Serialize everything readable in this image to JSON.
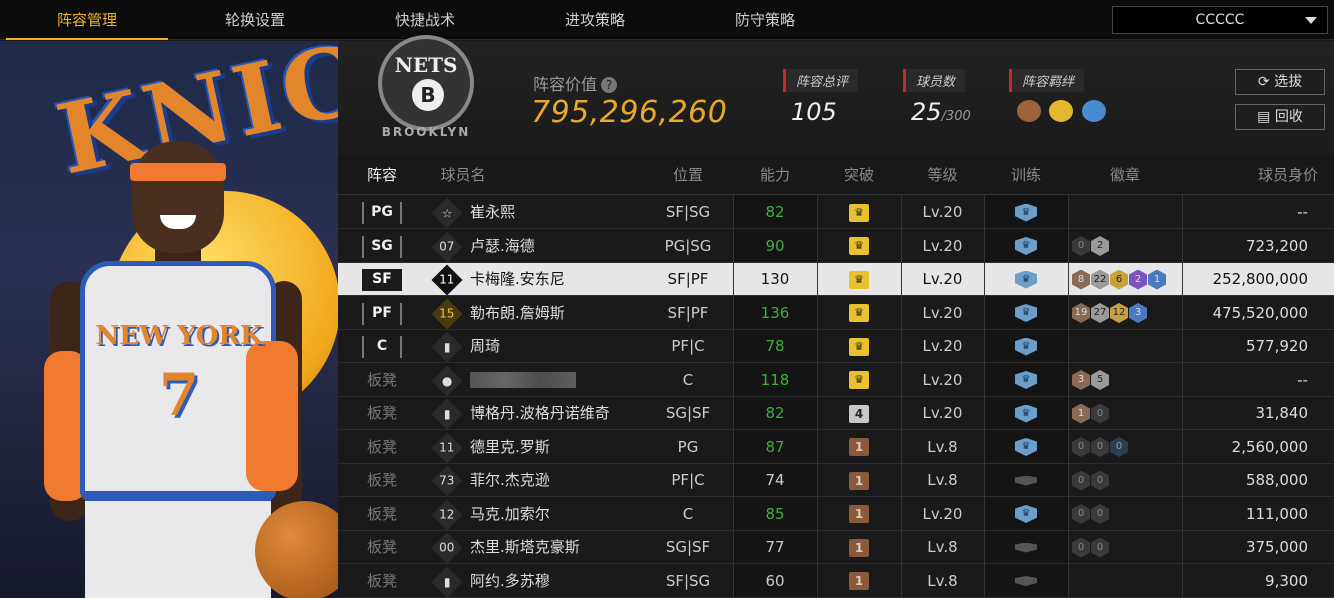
{
  "tabs": [
    "阵容管理",
    "轮换设置",
    "快捷战术",
    "进攻策略",
    "防守策略"
  ],
  "active_tab": 0,
  "team_select": {
    "value": "CCCCC"
  },
  "team_logo": {
    "top": "NETS",
    "letter": "B",
    "bottom": "BROOKLYN"
  },
  "art": {
    "sign": "KNICKS",
    "jersey_text": "NEW YORK",
    "jersey_number": "7"
  },
  "lineup_value": {
    "label": "阵容价值",
    "value": "795,296,260"
  },
  "overall": {
    "label": "阵容总评",
    "value": "105"
  },
  "player_count": {
    "label": "球员数",
    "value": "25",
    "max": "/300"
  },
  "bonds": {
    "label": "阵容羁绊",
    "icons": [
      "bond-icon-bronze",
      "bond-icon-gold",
      "bond-icon-blue"
    ]
  },
  "buttons": {
    "pick": "选拔",
    "recycle": "回收"
  },
  "columns": [
    "阵容",
    "球员名",
    "位置",
    "能力",
    "突破",
    "等级",
    "训练",
    "徽章",
    "球员身价"
  ],
  "rows": [
    {
      "slot": "PG",
      "bench": false,
      "jersey": "☆",
      "name": "崔永熙",
      "pos": "SF|SG",
      "ability": "82",
      "ability_green": true,
      "breakthrough": "crown",
      "level": "Lv.20",
      "training": "on",
      "badges": [],
      "worth": "--"
    },
    {
      "slot": "SG",
      "bench": false,
      "jersey": "07",
      "name": "卢瑟.海德",
      "pos": "PG|SG",
      "ability": "90",
      "ability_green": true,
      "breakthrough": "crown",
      "level": "Lv.20",
      "training": "on",
      "badges": [
        [
          "0",
          "dk"
        ],
        [
          "2",
          "si"
        ]
      ],
      "worth": "723,200"
    },
    {
      "slot": "SF",
      "bench": false,
      "jersey": "11",
      "name": "卡梅隆.安东尼",
      "pos": "SF|PF",
      "ability": "130",
      "ability_green": false,
      "breakthrough": "crown",
      "level": "Lv.20",
      "training": "on",
      "badges": [
        [
          "8",
          "br"
        ],
        [
          "22",
          "si"
        ],
        [
          "6",
          "go"
        ],
        [
          "2",
          "pu"
        ],
        [
          "1",
          "bl"
        ]
      ],
      "worth": "252,800,000",
      "selected": true
    },
    {
      "slot": "PF",
      "bench": false,
      "jersey": "15",
      "name": "勒布朗.詹姆斯",
      "pos": "SF|PF",
      "ability": "136",
      "ability_green": true,
      "breakthrough": "crown",
      "level": "Lv.20",
      "training": "on",
      "badges": [
        [
          "19",
          "br"
        ],
        [
          "27",
          "si"
        ],
        [
          "12",
          "go"
        ],
        [
          "3",
          "bl"
        ]
      ],
      "worth": "475,520,000",
      "gold_jersey": true
    },
    {
      "slot": "C",
      "bench": false,
      "jersey": "▮",
      "name": "周琦",
      "pos": "PF|C",
      "ability": "78",
      "ability_green": true,
      "breakthrough": "crown",
      "level": "Lv.20",
      "training": "on",
      "badges": [],
      "worth": "577,920"
    },
    {
      "slot": "板凳",
      "bench": true,
      "jersey": "●",
      "name": "",
      "blurred": true,
      "pos": "C",
      "ability": "118",
      "ability_green": true,
      "breakthrough": "crown",
      "level": "Lv.20",
      "training": "on",
      "badges": [
        [
          "3",
          "br"
        ],
        [
          "5",
          "si"
        ]
      ],
      "worth": "--"
    },
    {
      "slot": "板凳",
      "bench": true,
      "jersey": "▮",
      "name": "博格丹.波格丹诺维奇",
      "pos": "SG|SF",
      "ability": "82",
      "ability_green": true,
      "breakthrough": "4",
      "level": "Lv.20",
      "training": "on",
      "badges": [
        [
          "1",
          "br"
        ],
        [
          "0",
          "dk"
        ]
      ],
      "worth": "31,840"
    },
    {
      "slot": "板凳",
      "bench": true,
      "jersey": "11",
      "name": "德里克.罗斯",
      "pos": "PG",
      "ability": "87",
      "ability_green": true,
      "breakthrough": "1",
      "level": "Lv.8",
      "training": "on",
      "badges": [
        [
          "0",
          "dk"
        ],
        [
          "0",
          "dk"
        ],
        [
          "0",
          "dkb"
        ]
      ],
      "worth": "2,560,000"
    },
    {
      "slot": "板凳",
      "bench": true,
      "jersey": "73",
      "name": "菲尔.杰克逊",
      "pos": "PF|C",
      "ability": "74",
      "ability_green": false,
      "breakthrough": "1",
      "level": "Lv.8",
      "training": "off",
      "badges": [
        [
          "0",
          "dk"
        ],
        [
          "0",
          "dk"
        ]
      ],
      "worth": "588,000"
    },
    {
      "slot": "板凳",
      "bench": true,
      "jersey": "12",
      "name": "马克.加索尔",
      "pos": "C",
      "ability": "85",
      "ability_green": true,
      "breakthrough": "1",
      "level": "Lv.20",
      "training": "on",
      "badges": [
        [
          "0",
          "dk"
        ],
        [
          "0",
          "dk"
        ]
      ],
      "worth": "111,000"
    },
    {
      "slot": "板凳",
      "bench": true,
      "jersey": "00",
      "name": "杰里.斯塔克豪斯",
      "pos": "SG|SF",
      "ability": "77",
      "ability_green": false,
      "breakthrough": "1",
      "level": "Lv.8",
      "training": "off",
      "badges": [
        [
          "0",
          "dk"
        ],
        [
          "0",
          "dk"
        ]
      ],
      "worth": "375,000"
    },
    {
      "slot": "板凳",
      "bench": true,
      "jersey": "▮",
      "name": "阿约.多苏穆",
      "pos": "SF|SG",
      "ability": "60",
      "ability_green": false,
      "breakthrough": "1",
      "level": "Lv.8",
      "training": "off",
      "badges": [],
      "worth": "9,300"
    }
  ]
}
